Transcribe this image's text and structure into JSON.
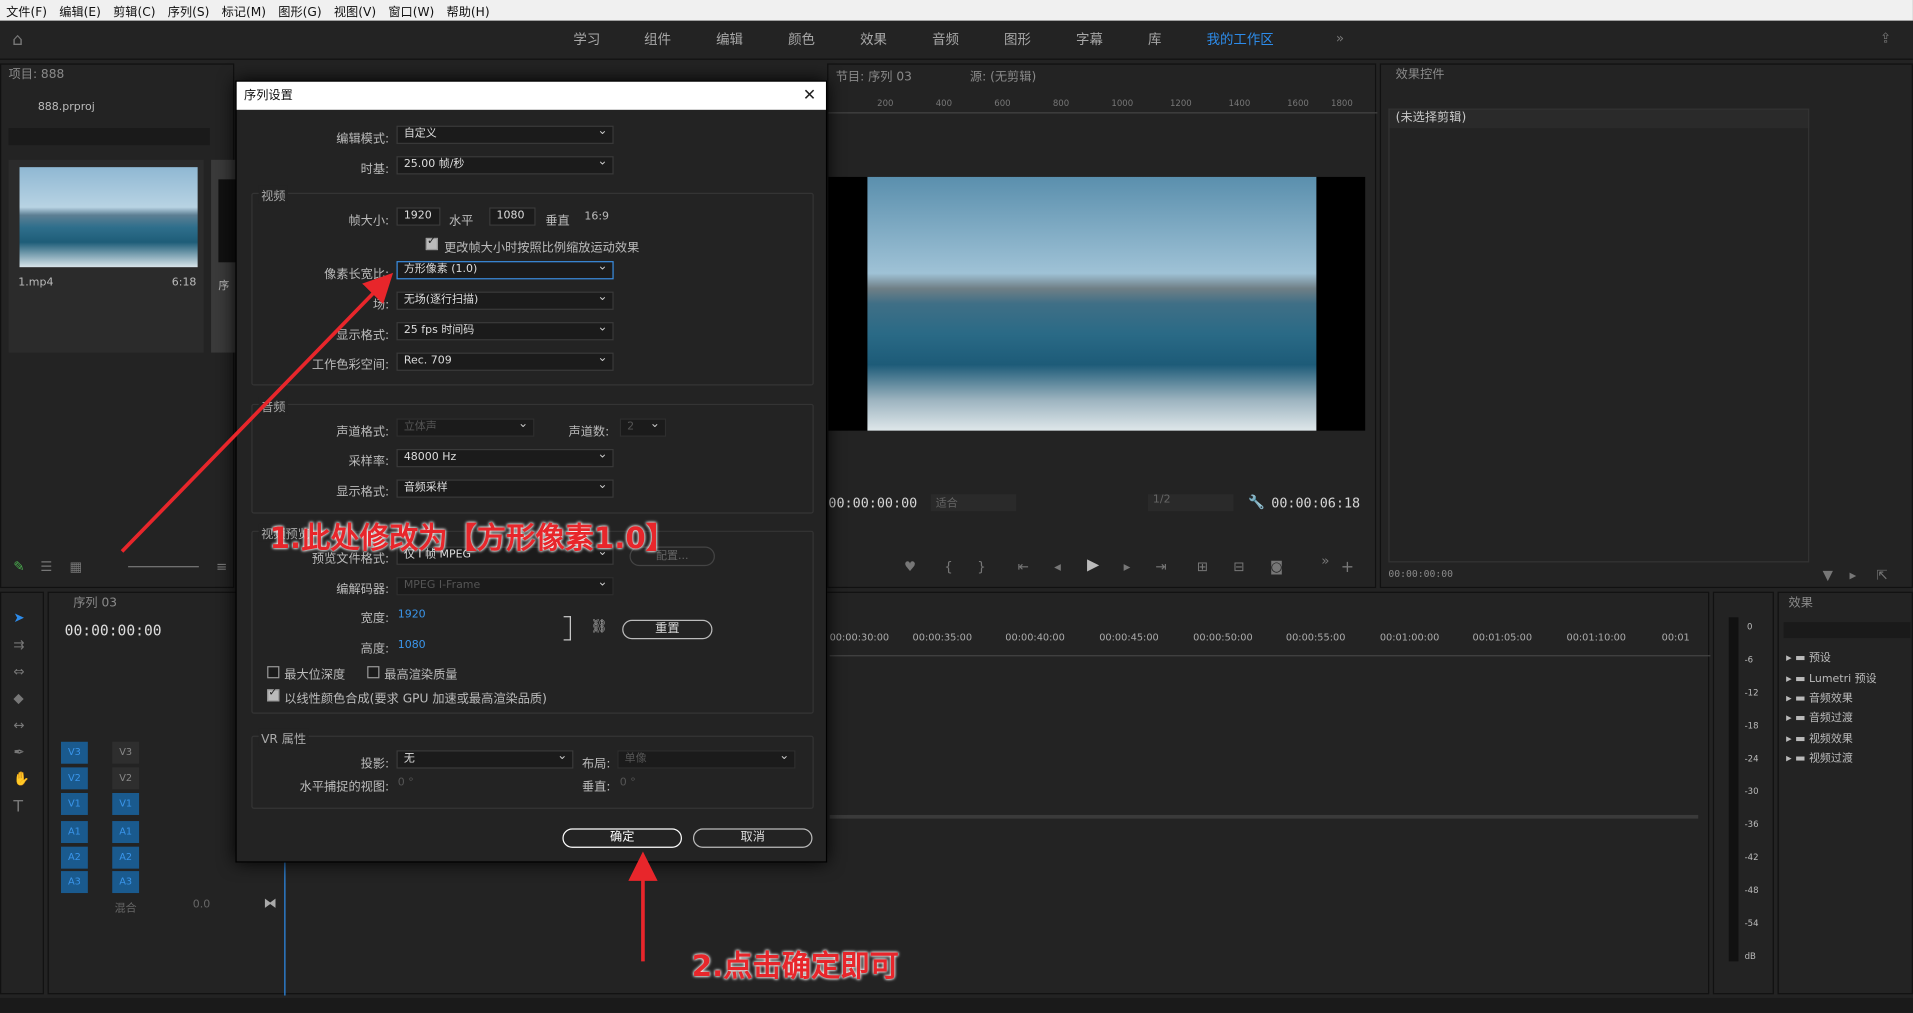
{
  "menu": [
    "文件(F)",
    "编辑(E)",
    "剪辑(C)",
    "序列(S)",
    "标记(M)",
    "图形(G)",
    "视图(V)",
    "窗口(W)",
    "帮助(H)"
  ],
  "workspaces": [
    "学习",
    "组件",
    "编辑",
    "颜色",
    "效果",
    "音频",
    "图形",
    "字幕",
    "库",
    "我的工作区"
  ],
  "project": {
    "title": "项目: 888",
    "file": "888.prproj",
    "clip_name": "1.mp4",
    "clip_duration": "6:18",
    "seq_label": "序"
  },
  "program": {
    "tab1": "节目: 序列 03",
    "tab2": "源: (无剪辑)",
    "ruler": [
      "200",
      "400",
      "600",
      "800",
      "1000",
      "1200",
      "1400",
      "1600",
      "1800"
    ],
    "timecode_left": "00:00:00:00",
    "fit": "适合",
    "quality": "1/2",
    "timecode_right": "00:00:06:18"
  },
  "effect_controls": {
    "title": "效果控件",
    "no_clip": "(未选择剪辑)",
    "timecode": "00:00:00:00"
  },
  "timeline": {
    "tab": "序列 03",
    "timecode": "00:00:00:00",
    "ruler": [
      "00:00:30:00",
      "00:00:35:00",
      "00:00:40:00",
      "00:00:45:00",
      "00:00:50:00",
      "00:00:55:00",
      "00:01:00:00",
      "00:01:05:00",
      "00:01:10:00",
      "00:01"
    ],
    "mix_label": "混合",
    "mix_value": "0.0",
    "tracks_v": [
      [
        "V3",
        "V3"
      ],
      [
        "V2",
        "V2"
      ],
      [
        "V1",
        "V1"
      ]
    ],
    "tracks_a": [
      [
        "A1",
        "A1"
      ],
      [
        "A2",
        "A2"
      ],
      [
        "A3",
        "A3"
      ]
    ]
  },
  "meter": [
    "0",
    "-6",
    "-12",
    "-18",
    "-24",
    "-30",
    "-36",
    "-42",
    "-48",
    "-54",
    "dB"
  ],
  "effects": {
    "title": "效果",
    "items": [
      "预设",
      "Lumetri 预设",
      "音频效果",
      "音频过渡",
      "视频效果",
      "视频过渡"
    ]
  },
  "dialog": {
    "title": "序列设置",
    "edit_mode_label": "编辑模式:",
    "edit_mode": "自定义",
    "timebase_label": "时基:",
    "timebase": "25.00  帧/秒",
    "video_group": "视频",
    "frame_size_label": "帧大小:",
    "frame_w": "1920",
    "h_label": "水平",
    "frame_h": "1080",
    "v_label": "垂直",
    "aspect": "16:9",
    "scale_check": "更改帧大小时按照比例缩放运动效果",
    "par_label": "像素长宽比:",
    "par": "方形像素 (1.0)",
    "field_label": "场:",
    "field": "无场(逐行扫描)",
    "display_label": "显示格式:",
    "display": "25 fps 时间码",
    "color_label": "工作色彩空间:",
    "color": "Rec. 709",
    "audio_group": "音频",
    "channel_label": "声道格式:",
    "channel": "立体声",
    "channels_label": "声道数:",
    "channels": "2",
    "rate_label": "采样率:",
    "rate": "48000 Hz",
    "adisplay_label": "显示格式:",
    "adisplay": "音频采样",
    "preview_group": "视频预览",
    "preview_fmt_label": "预览文件格式:",
    "preview_fmt": "仅 I 帧 MPEG",
    "config": "配置...",
    "codec_label": "编解码器:",
    "codec": "MPEG I-Frame",
    "width_label": "宽度:",
    "width": "1920",
    "height_label": "高度:",
    "height": "1080",
    "reset": "重置",
    "max_depth": "最大位深度",
    "max_quality": "最高渲染质量",
    "linear": "以线性颜色合成(要求 GPU 加速或最高渲染品质)",
    "vr_group": "VR 属性",
    "proj_label": "投影:",
    "proj": "无",
    "layout_label": "布局:",
    "layout": "单像",
    "hcap_label": "水平捕捉的视图:",
    "hcap": "0 °",
    "vert_label": "垂直:",
    "vert": "0 °",
    "ok": "确定",
    "cancel": "取消"
  },
  "annotations": {
    "a1": "1.此处修改为【方形像素1.0】",
    "a2": "2.点击确定即可"
  },
  "colors": {
    "accent": "#2d8ceb",
    "track": "#1a5a8e",
    "annotation": "#e8262b"
  }
}
